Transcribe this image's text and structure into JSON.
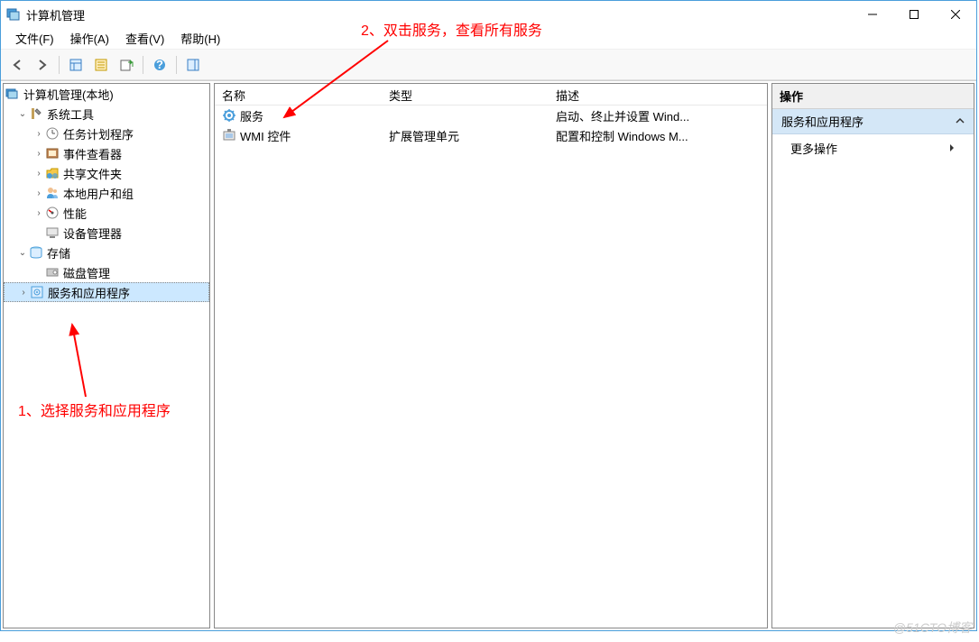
{
  "window": {
    "title": "计算机管理"
  },
  "menu": {
    "file": "文件(F)",
    "action": "操作(A)",
    "view": "查看(V)",
    "help": "帮助(H)"
  },
  "tree": {
    "root": "计算机管理(本地)",
    "system_tools": "系统工具",
    "task_scheduler": "任务计划程序",
    "event_viewer": "事件查看器",
    "shared_folders": "共享文件夹",
    "local_users": "本地用户和组",
    "performance": "性能",
    "device_manager": "设备管理器",
    "storage": "存储",
    "disk_management": "磁盘管理",
    "services_apps": "服务和应用程序"
  },
  "list": {
    "headers": {
      "name": "名称",
      "type": "类型",
      "description": "描述"
    },
    "rows": [
      {
        "name": "服务",
        "type": "",
        "desc": "启动、终止并设置 Wind..."
      },
      {
        "name": "WMI 控件",
        "type": "扩展管理单元",
        "desc": "配置和控制 Windows M..."
      }
    ]
  },
  "actions": {
    "header": "操作",
    "group": "服务和应用程序",
    "more": "更多操作"
  },
  "annotations": {
    "top": "2、双击服务，查看所有服务",
    "bottom": "1、选择服务和应用程序"
  },
  "watermark": "@51CTO博客"
}
